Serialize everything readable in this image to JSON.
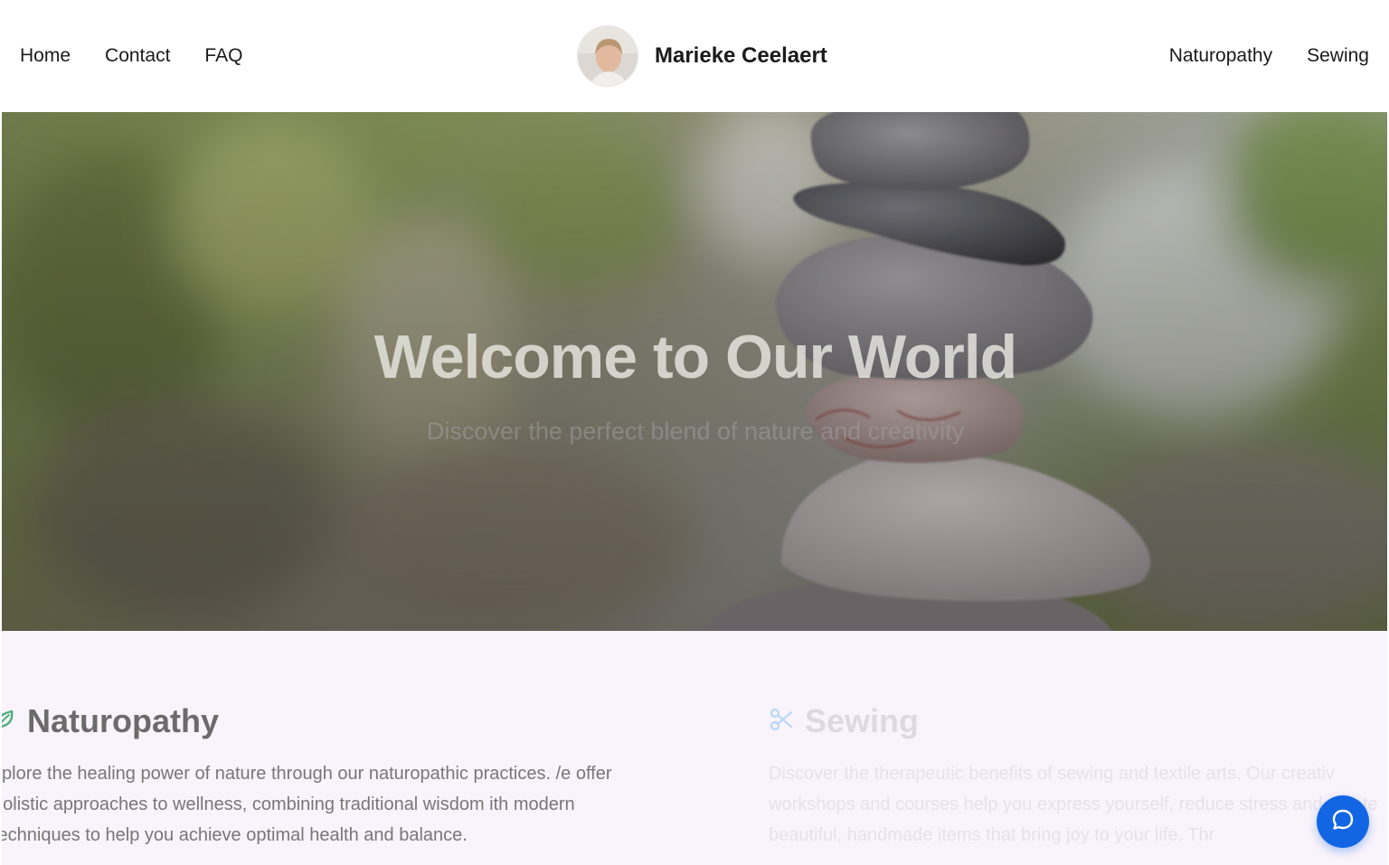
{
  "nav": {
    "left_links": [
      "Home",
      "Contact",
      "FAQ"
    ],
    "brand_name": "Marieke Ceelaert",
    "right_links": [
      "Naturopathy",
      "Sewing"
    ]
  },
  "hero": {
    "title": "Welcome to Our World",
    "subtitle": "Discover the perfect blend of nature and creativity"
  },
  "features": [
    {
      "title": "Naturopathy",
      "icon": "leaf-icon",
      "icon_color": "#4caf7a",
      "text": "xplore the healing power of nature through our naturopathic practices. /e offer holistic approaches to wellness, combining traditional wisdom ith modern techniques to help you achieve optimal health and balance."
    },
    {
      "title": "Sewing",
      "icon": "scissors-icon",
      "icon_color": "#b9d7f5",
      "text": "Discover the therapeutic benefits of sewing and textile arts. Our creativ workshops and courses help you express yourself, reduce stress and create beautiful, handmade items that bring joy to your life. Thr"
    }
  ],
  "chat": {
    "icon": "chat-bubble-icon",
    "color": "#1266e4"
  }
}
